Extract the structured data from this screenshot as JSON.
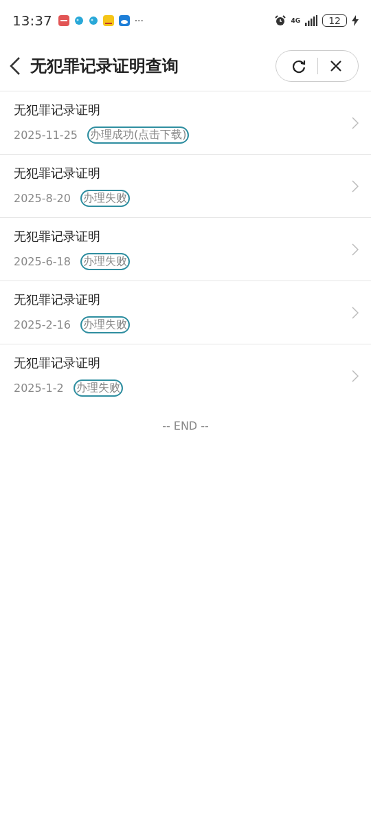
{
  "status_bar": {
    "time": "13:37",
    "more": "···",
    "network": "4G",
    "battery": "12"
  },
  "nav": {
    "title": "无犯罪记录证明查询"
  },
  "records": [
    {
      "title": "无犯罪记录证明",
      "date": "2025-11-25",
      "status": "办理成功(点击下载)"
    },
    {
      "title": "无犯罪记录证明",
      "date": "2025-8-20",
      "status": "办理失败"
    },
    {
      "title": "无犯罪记录证明",
      "date": "2025-6-18",
      "status": "办理失败"
    },
    {
      "title": "无犯罪记录证明",
      "date": "2025-2-16",
      "status": "办理失败"
    },
    {
      "title": "无犯罪记录证明",
      "date": "2025-1-2",
      "status": "办理失败"
    }
  ],
  "end_text": "-- END --"
}
